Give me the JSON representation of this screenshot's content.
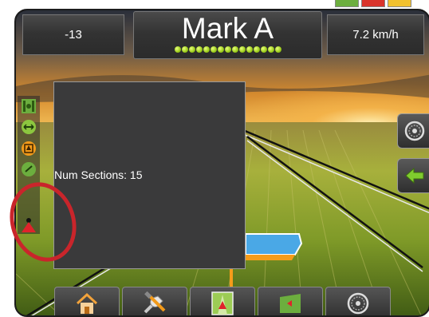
{
  "status_flags": [
    "green",
    "red",
    "yellow"
  ],
  "header": {
    "left_value": "-13",
    "title": "Mark A",
    "right_value": "7.2 km/h",
    "section_led_count": 15
  },
  "popup": {
    "num_sections_text": "Num Sections: 15"
  },
  "left_toolbar": [
    "guidance-mode-icon",
    "swath-width-icon",
    "steering-icon",
    "gps-status-icon",
    "boundary-marker-icon"
  ],
  "right_buttons": [
    "steering-wheel-icon",
    "back-arrow-icon"
  ],
  "bottom_tabs": [
    "home-icon",
    "tools-icon",
    "guidance-icon",
    "field-mark-icon",
    "steering-wheel-icon"
  ],
  "colors": {
    "accent_green": "#6cae3e",
    "led_green": "#9ccc1b",
    "alert_red": "#d9342b",
    "annotation_red": "#c9252b",
    "panel_gray": "#3a3a3b"
  }
}
